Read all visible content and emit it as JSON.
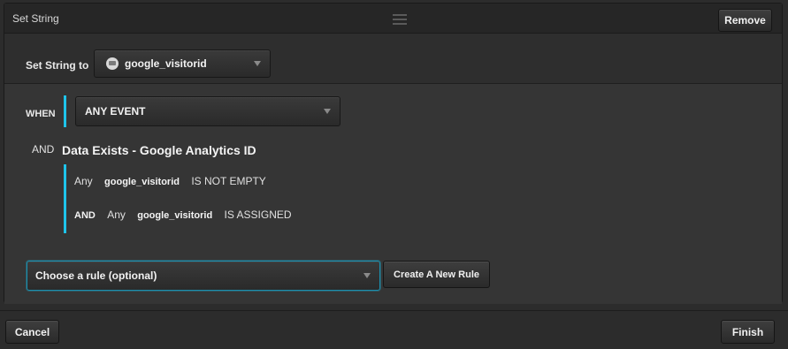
{
  "panel": {
    "title": "Set String",
    "remove_label": "Remove"
  },
  "set_string": {
    "label": "Set String to",
    "variable": "google_visitorid",
    "icon": "data-element-icon"
  },
  "when": {
    "label": "WHEN",
    "event": "ANY EVENT"
  },
  "and_condition": {
    "and_label": "AND",
    "title": "Data Exists - Google Analytics ID",
    "lines": [
      {
        "prefix": "",
        "scope": "Any",
        "variable": "google_visitorid",
        "operator": "IS NOT EMPTY"
      },
      {
        "prefix": "AND",
        "scope": "Any",
        "variable": "google_visitorid",
        "operator": "IS ASSIGNED"
      }
    ]
  },
  "rule": {
    "placeholder": "Choose a rule (optional)",
    "create_label": "Create A New Rule"
  },
  "footer": {
    "cancel_label": "Cancel",
    "finish_label": "Finish"
  },
  "colors": {
    "accent": "#1ec4ea",
    "background": "#2c2c2c",
    "panel": "#2e2e2e"
  }
}
